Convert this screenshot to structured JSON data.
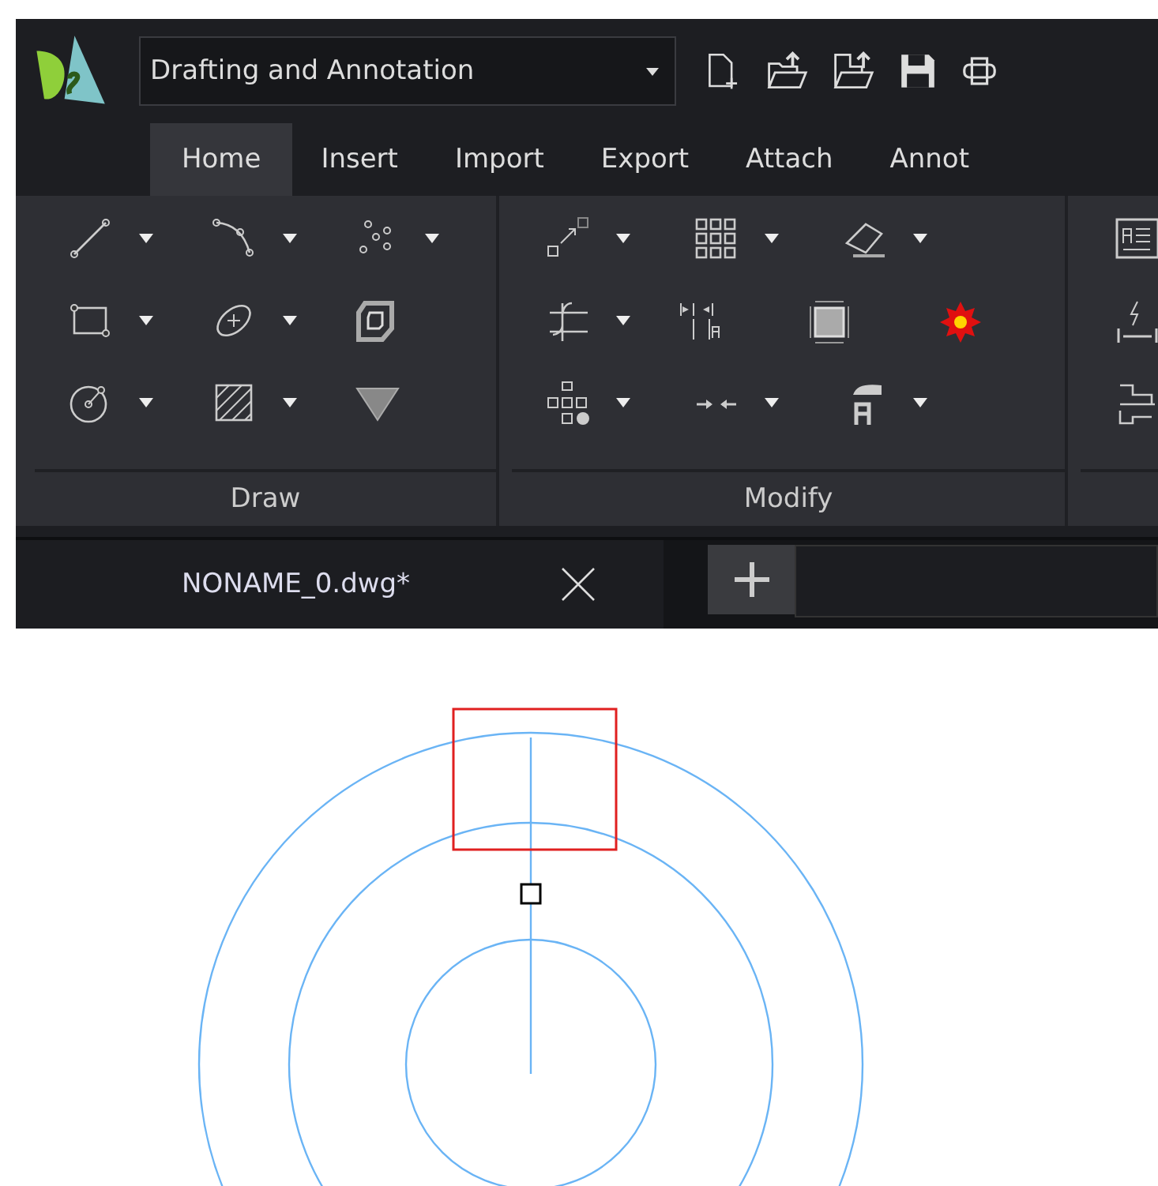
{
  "workspace": {
    "value": "Drafting and Annotation"
  },
  "tabs": [
    {
      "label": "Home",
      "selected": true
    },
    {
      "label": "Insert",
      "selected": false
    },
    {
      "label": "Import",
      "selected": false
    },
    {
      "label": "Export",
      "selected": false
    },
    {
      "label": "Attach",
      "selected": false
    },
    {
      "label": "Annot",
      "selected": false
    }
  ],
  "panels": [
    {
      "title": "Draw",
      "rows": [
        [
          {
            "dropdown": true
          },
          {
            "dropdown": true
          },
          {
            "dropdown": true
          }
        ],
        [
          {
            "dropdown": true
          },
          {
            "dropdown": true
          },
          {
            "dropdown": false
          }
        ],
        [
          {
            "dropdown": true
          },
          {
            "dropdown": true
          },
          {
            "dropdown": false
          }
        ]
      ]
    },
    {
      "title": "Modify",
      "rows": [
        [
          {
            "dropdown": true
          },
          {
            "dropdown": true
          },
          {
            "dropdown": true
          }
        ],
        [
          {
            "dropdown": true
          },
          {
            "dropdown": false
          },
          {
            "dropdown": false
          },
          {
            "dropdown": false
          }
        ],
        [
          {
            "dropdown": true
          },
          {
            "dropdown": true
          },
          {
            "dropdown": true
          }
        ]
      ]
    },
    {
      "rows": [
        [
          {
            "dropdown": false
          }
        ],
        [
          {
            "dropdown": false
          }
        ],
        [
          {
            "dropdown": false
          }
        ]
      ]
    }
  ],
  "document_tabs": [
    {
      "title": "NONAME_0.dwg*"
    }
  ]
}
